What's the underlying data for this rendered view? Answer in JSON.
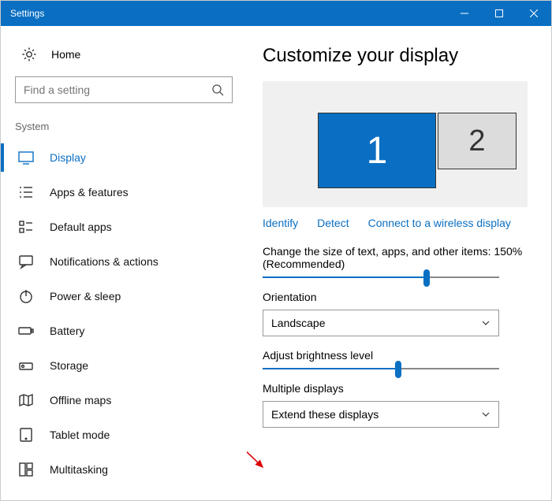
{
  "window": {
    "title": "Settings"
  },
  "sidebar": {
    "home": "Home",
    "search_placeholder": "Find a setting",
    "group": "System",
    "items": [
      {
        "label": "Display"
      },
      {
        "label": "Apps & features"
      },
      {
        "label": "Default apps"
      },
      {
        "label": "Notifications & actions"
      },
      {
        "label": "Power & sleep"
      },
      {
        "label": "Battery"
      },
      {
        "label": "Storage"
      },
      {
        "label": "Offline maps"
      },
      {
        "label": "Tablet mode"
      },
      {
        "label": "Multitasking"
      }
    ]
  },
  "main": {
    "heading": "Customize your display",
    "monitor1": "1",
    "monitor2": "2",
    "actions": {
      "identify": "Identify",
      "detect": "Detect",
      "wireless": "Connect to a wireless display"
    },
    "scale_label": "Change the size of text, apps, and other items: 150% (Recommended)",
    "orientation_label": "Orientation",
    "orientation_value": "Landscape",
    "brightness_label": "Adjust brightness level",
    "multiple_label": "Multiple displays",
    "multiple_value": "Extend these displays"
  }
}
